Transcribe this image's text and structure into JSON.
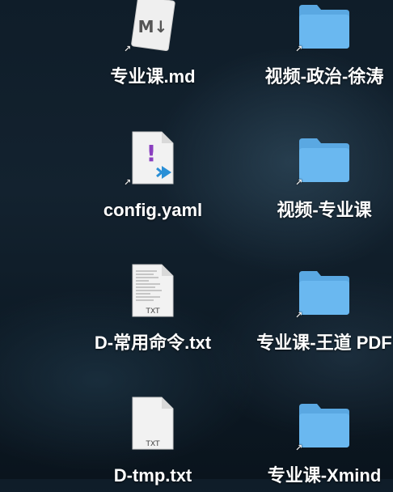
{
  "desktop_items": [
    {
      "label": "专业课.md",
      "kind": "markdown-file",
      "icon": "markdown-icon",
      "badge": "M↓"
    },
    {
      "label": "视频-政治-徐涛",
      "kind": "folder-alias",
      "icon": "folder-icon"
    },
    {
      "label": "config.yaml",
      "kind": "yaml-file",
      "icon": "vscode-yaml-icon",
      "badge": "!"
    },
    {
      "label": "视频-专业课",
      "kind": "folder-alias",
      "icon": "folder-icon"
    },
    {
      "label": "D-常用命令.txt",
      "kind": "text-file",
      "icon": "text-document-icon",
      "badge": "TXT"
    },
    {
      "label": "专业课-王道 PDF",
      "kind": "folder-alias",
      "icon": "folder-icon"
    },
    {
      "label": "D-tmp.txt",
      "kind": "text-file",
      "icon": "text-document-icon",
      "badge": "TXT"
    },
    {
      "label": "专业课-Xmind",
      "kind": "folder-alias",
      "icon": "folder-icon"
    }
  ],
  "alias_arrow": "↗",
  "colors": {
    "folder": "#6ab8f0",
    "folder_tab": "#5aa8e2",
    "label_text": "#ffffff"
  }
}
